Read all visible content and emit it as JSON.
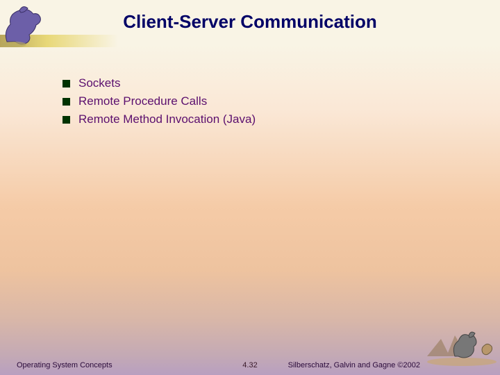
{
  "title": "Client-Server Communication",
  "bullets": [
    "Sockets",
    "Remote Procedure Calls",
    "Remote Method Invocation (Java)"
  ],
  "footer": {
    "left": "Operating System Concepts",
    "center": "4.32",
    "right": "Silberschatz, Galvin and Gagne ©2002"
  }
}
